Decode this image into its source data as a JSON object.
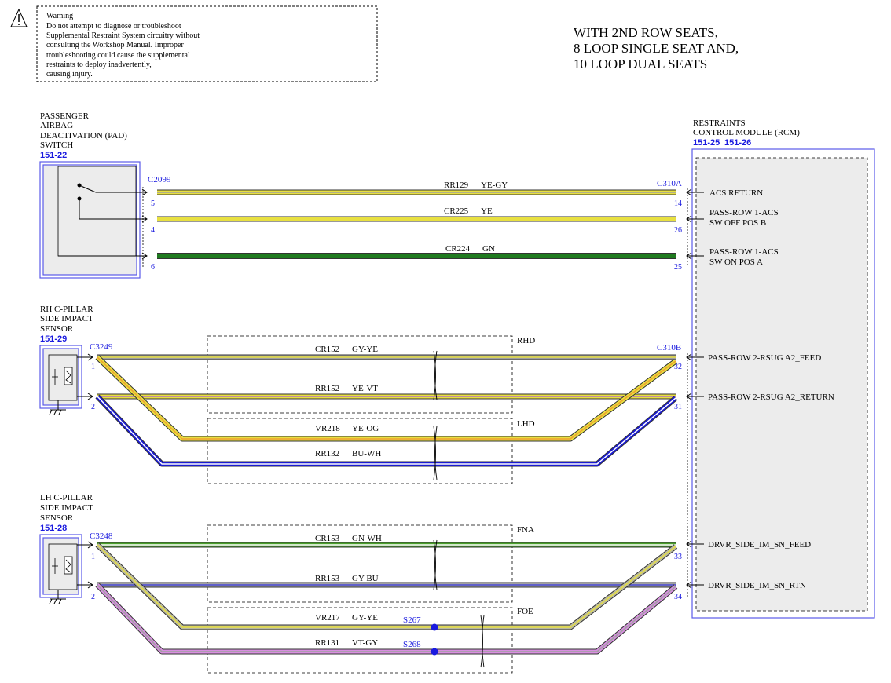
{
  "warning": {
    "lines": [
      "Warning",
      "Do not attempt to diagnose or troubleshoot",
      "Supplemental Restraint System circuitry without",
      "consulting the Workshop Manual. Improper",
      "troubleshooting could cause the supplemental",
      "restraints to deploy inadvertently,",
      "causing injury."
    ]
  },
  "title": {
    "lines": [
      "WITH 2ND ROW SEATS,",
      "8 LOOP SINGLE SEAT AND,",
      "10 LOOP DUAL SEATS"
    ]
  },
  "components": {
    "pad_switch": {
      "lines": [
        "PASSENGER",
        "AIRBAG",
        "DEACTIVATION (PAD)",
        "SWITCH"
      ],
      "ref": "151-22",
      "connector": "C2099"
    },
    "rh_sensor": {
      "lines": [
        "RH C-PILLAR",
        "SIDE IMPACT",
        "SENSOR"
      ],
      "ref": "151-29",
      "connector": "C3249"
    },
    "lh_sensor": {
      "lines": [
        "LH C-PILLAR",
        "SIDE IMPACT",
        "SENSOR"
      ],
      "ref": "151-28",
      "connector": "C3248"
    },
    "rcm": {
      "lines": [
        "RESTRAINTS",
        "CONTROL MODULE (RCM)"
      ],
      "ref1": "151-25",
      "ref2": "151-26",
      "connector_a": "C310A",
      "connector_b": "C310B",
      "pins": [
        {
          "num": "14",
          "label": [
            "ACS RETURN"
          ]
        },
        {
          "num": "26",
          "label": [
            "PASS-ROW 1-ACS",
            "SW OFF POS B"
          ]
        },
        {
          "num": "25",
          "label": [
            "PASS-ROW 1-ACS",
            "SW ON POS A"
          ]
        },
        {
          "num": "32",
          "label": [
            "PASS-ROW 2-RSUG A2_FEED"
          ]
        },
        {
          "num": "31",
          "label": [
            "PASS-ROW 2-RSUG A2_RETURN"
          ]
        },
        {
          "num": "33",
          "label": [
            "DRVR_SIDE_IM_SN_FEED"
          ]
        },
        {
          "num": "34",
          "label": [
            "DRVR_SIDE_IM_SN_RTN"
          ]
        }
      ]
    }
  },
  "source_pins": [
    "5",
    "4",
    "6",
    "1",
    "2",
    "1",
    "2"
  ],
  "wires": [
    {
      "circuit": "RR129",
      "color": "YE-GY",
      "stroke": "#e8e040",
      "stripe": "#a0a0a0"
    },
    {
      "circuit": "CR225",
      "color": "YE",
      "stroke": "#e8e040",
      "stripe": ""
    },
    {
      "circuit": "CR224",
      "color": "GN",
      "stroke": "#1f7a1f",
      "stripe": ""
    },
    {
      "circuit": "CR152",
      "color": "GY-YE",
      "stroke": "#a0a0a0",
      "stripe": "#e8e040"
    },
    {
      "circuit": "RR152",
      "color": "YE-VT",
      "stroke": "#e8e040",
      "stripe": "#b070c8"
    },
    {
      "circuit": "VR218",
      "color": "YE-OG",
      "stroke": "#e8e040",
      "stripe": "#f0a030"
    },
    {
      "circuit": "RR132",
      "color": "BU-WH",
      "stroke": "#1a1ad0",
      "stripe": "#ffffff"
    },
    {
      "circuit": "CR153",
      "color": "GN-WH",
      "stroke": "#4aa02a",
      "stripe": "#ffffff"
    },
    {
      "circuit": "RR153",
      "color": "GY-BU",
      "stroke": "#a0a0a0",
      "stripe": "#4a4ad8"
    },
    {
      "circuit": "VR217",
      "color": "GY-YE",
      "stroke": "#b8b8a0",
      "stripe": "#e8e040"
    },
    {
      "circuit": "RR131",
      "color": "VT-GY",
      "stroke": "#d890e0",
      "stripe": "#a0a0a0"
    }
  ],
  "splices": [
    "S267",
    "S268"
  ],
  "options": [
    "RHD",
    "LHD",
    "FNA",
    "FOE"
  ]
}
